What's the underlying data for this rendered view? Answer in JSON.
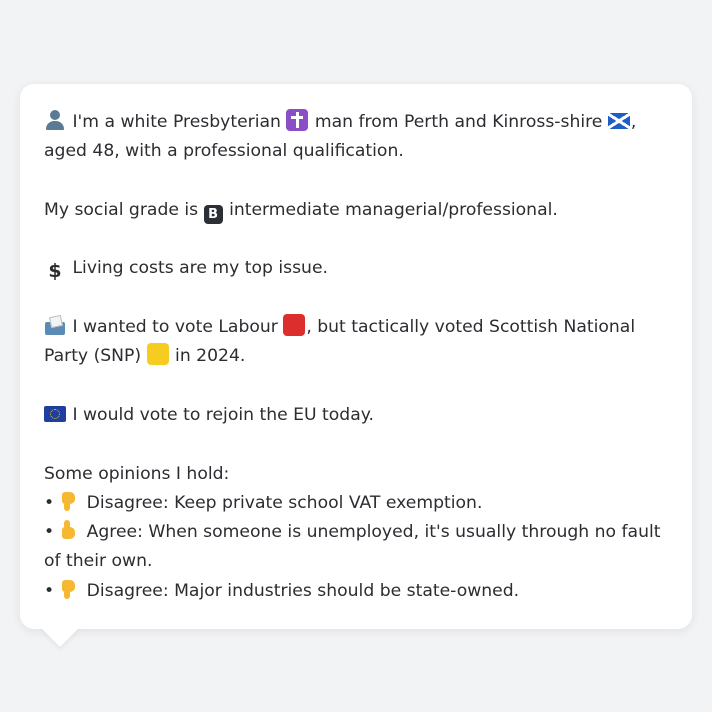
{
  "message": {
    "intro": {
      "emoji_person": "person-silhouette-icon",
      "part1": "I'm a white Presbyterian",
      "emoji_cross": "latin-cross-icon",
      "part2": "man from Perth and Kinross-shire",
      "emoji_flag": "scotland-flag-icon",
      "part3": ", aged 48, with a professional qualification."
    },
    "social_grade": {
      "part1": "My social grade is",
      "emoji_b": "B",
      "part2": "intermediate managerial/professional."
    },
    "issue": {
      "emoji": "$",
      "text": "Living costs are my top issue."
    },
    "vote": {
      "emoji_ballot": "ballot-box-icon",
      "part1": "I wanted to vote Labour",
      "emoji_red": "red-square-icon",
      "part2": ", but tactically voted Scottish National Party (SNP)",
      "emoji_yellow": "yellow-square-icon",
      "part3": "in 2024."
    },
    "eu": {
      "emoji": "eu-flag-icon",
      "text": "I would vote to rejoin the EU today."
    },
    "opinions": {
      "heading": "Some opinions I hold:",
      "items": [
        {
          "bullet": "•",
          "stance": "Disagree",
          "emoji": "thumbs-down-icon",
          "text": "Disagree: Keep private school VAT exemption."
        },
        {
          "bullet": "•",
          "stance": "Agree",
          "emoji": "thumbs-up-icon",
          "text": "Agree: When someone is unemployed, it's usually through no fault of their own."
        },
        {
          "bullet": "•",
          "stance": "Disagree",
          "emoji": "thumbs-down-icon",
          "text": "Disagree: Major industries should be state-owned."
        }
      ]
    }
  },
  "colors": {
    "background": "#f2f3f5",
    "bubble": "#ffffff",
    "text": "#2b2d31"
  }
}
